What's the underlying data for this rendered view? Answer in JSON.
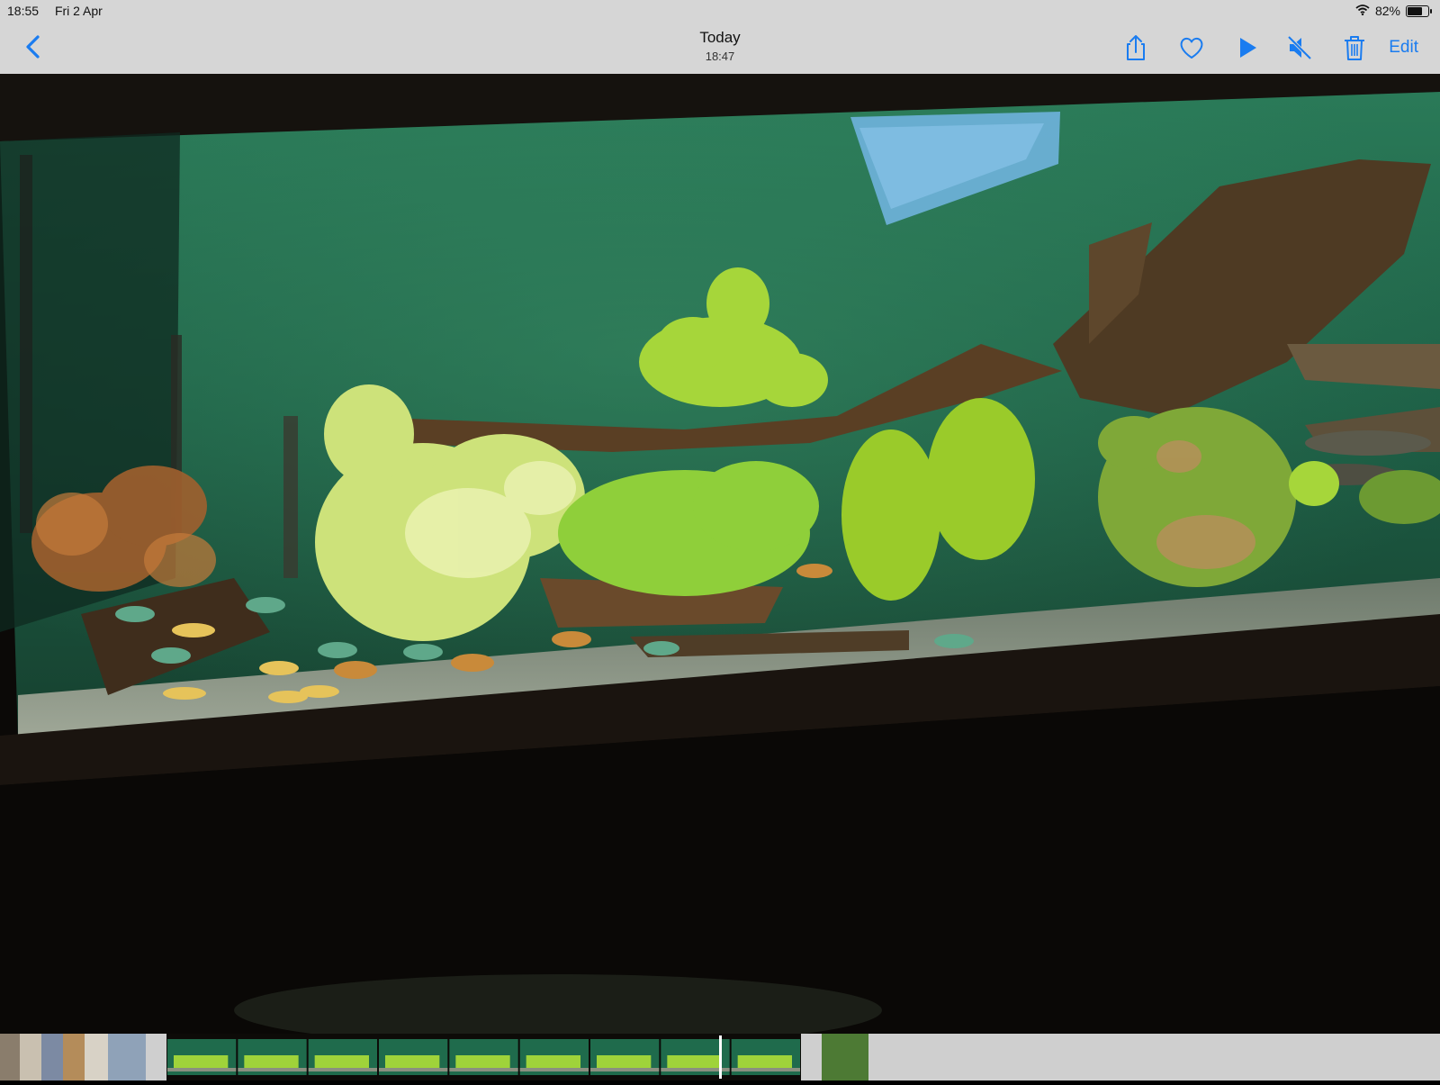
{
  "status_bar": {
    "time": "18:55",
    "date": "Fri 2 Apr",
    "battery_percent": "82%",
    "battery_level": 0.82,
    "wifi_icon": "wifi-icon",
    "battery_icon": "battery-icon"
  },
  "nav": {
    "back_icon": "chevron-left-icon",
    "title": "Today",
    "subtitle": "18:47",
    "actions": [
      "share-icon",
      "heart-icon",
      "play-icon",
      "speaker-muted-icon",
      "trash-icon"
    ],
    "edit_label": "Edit",
    "accent_color": "#1a7cf0"
  },
  "photo": {
    "subject_colors": {
      "water": "#1f6b4c",
      "frame": "#0c0a08",
      "plants": "#9fd33a",
      "wood": "#5a3f24"
    }
  },
  "filmstrip": {
    "photo_thumbnails": 6,
    "video_frames": 9,
    "selected_frame": 8
  }
}
